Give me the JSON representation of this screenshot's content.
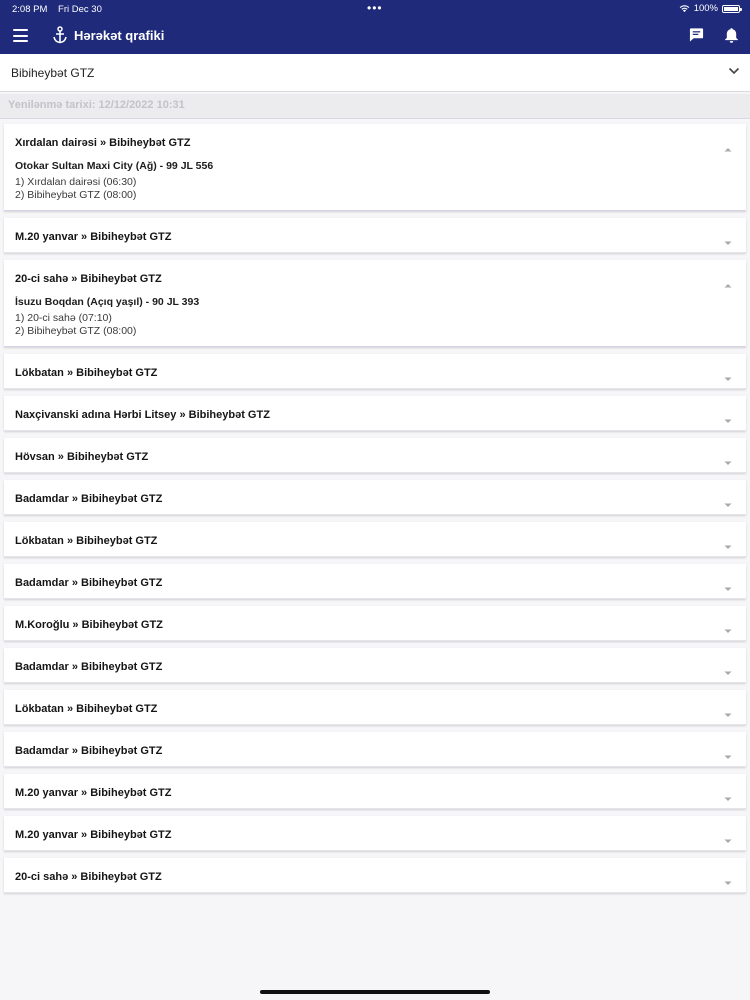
{
  "status_bar": {
    "time": "2:08 PM",
    "date": "Fri Dec 30",
    "battery": "100%",
    "battery_level": 1.0
  },
  "header": {
    "title": "Hərəkət qrafiki",
    "icons": [
      "menu-icon",
      "logo-icon",
      "chat-icon",
      "bell-icon"
    ]
  },
  "selector": {
    "value": "Bibiheybət GTZ"
  },
  "updated": {
    "text": "Yenilənmə tarixi: 12/12/2022 10:31"
  },
  "routes": [
    {
      "title": "Xırdalan dairəsi » Bibiheybət GTZ",
      "expanded": true,
      "vehicle": "Otokar Sultan Maxi City (Ağ) - 99 JL 556",
      "stops": [
        "1) Xırdalan dairəsi (06:30)",
        "2) Bibiheybət GTZ (08:00)"
      ]
    },
    {
      "title": "M.20 yanvar » Bibiheybət GTZ",
      "expanded": false
    },
    {
      "title": "20-ci sahə » Bibiheybət GTZ",
      "expanded": true,
      "vehicle": "İsuzu Boqdan (Açıq yaşıl) - 90 JL 393",
      "stops": [
        "1) 20-ci sahə (07:10)",
        "2) Bibiheybət GTZ (08:00)"
      ]
    },
    {
      "title": "Lökbatan » Bibiheybət GTZ",
      "expanded": false
    },
    {
      "title": "Naxçivanski adına Hərbi Litsey » Bibiheybət GTZ",
      "expanded": false
    },
    {
      "title": "Hövsan » Bibiheybət GTZ",
      "expanded": false
    },
    {
      "title": "Badamdar » Bibiheybət GTZ",
      "expanded": false
    },
    {
      "title": "Lökbatan » Bibiheybət GTZ",
      "expanded": false
    },
    {
      "title": "Badamdar » Bibiheybət GTZ",
      "expanded": false
    },
    {
      "title": "M.Koroğlu » Bibiheybət GTZ",
      "expanded": false
    },
    {
      "title": "Badamdar » Bibiheybət GTZ",
      "expanded": false
    },
    {
      "title": "Lökbatan » Bibiheybət GTZ",
      "expanded": false
    },
    {
      "title": "Badamdar » Bibiheybət GTZ",
      "expanded": false
    },
    {
      "title": "M.20 yanvar » Bibiheybət GTZ",
      "expanded": false
    },
    {
      "title": "M.20 yanvar » Bibiheybət GTZ",
      "expanded": false
    },
    {
      "title": "20-ci sahə » Bibiheybət GTZ",
      "expanded": false
    }
  ],
  "colors": {
    "header_bg": "#1f2b7a",
    "page_bg": "#f6f6f8",
    "card_bg": "#ffffff"
  }
}
